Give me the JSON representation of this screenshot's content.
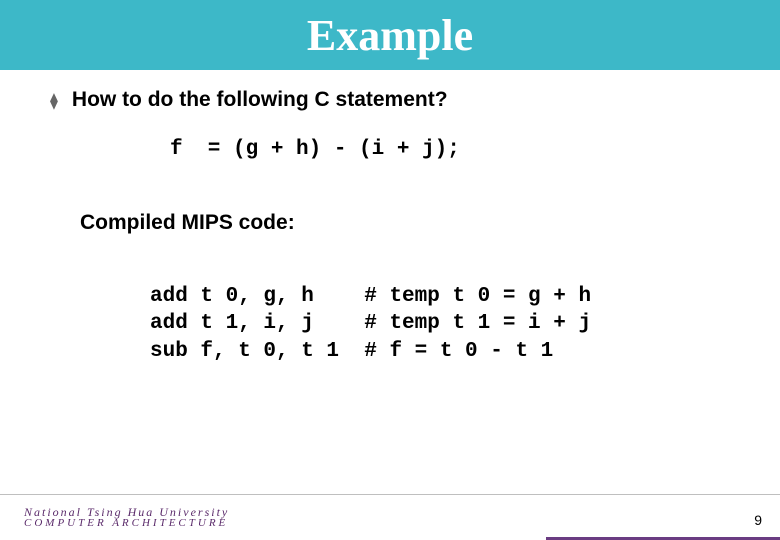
{
  "title": "Example",
  "question": "How to do the following C statement?",
  "c_code": "f  = (g + h) - (i + j);",
  "subhead": "Compiled MIPS code:",
  "mips_code": "add t 0, g, h    # temp t 0 = g + h\nadd t 1, i, j    # temp t 1 = i + j\nsub f, t 0, t 1  # f = t 0 - t 1",
  "footer": {
    "brand_line1": "National Tsing Hua University",
    "brand_line2": "COMPUTER ARCHITECTURE"
  },
  "page_number": "9"
}
